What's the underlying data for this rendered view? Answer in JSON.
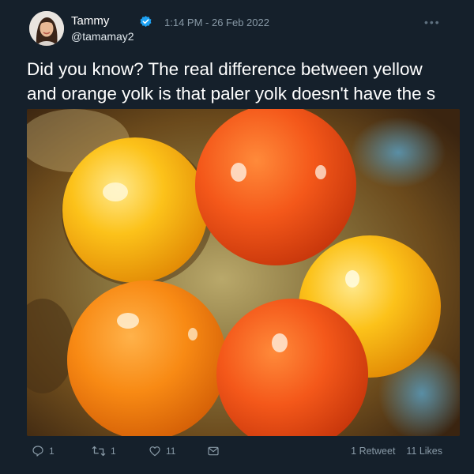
{
  "author": {
    "display_name": "Tammy",
    "handle": "@tamamay2",
    "verified": true,
    "avatar_icon": "person-avatar"
  },
  "timestamp": "1:14 PM - 26 Feb 2022",
  "more_icon": "ellipsis-icon",
  "text": "Did you know? The real difference between yellow and orange yolk is that paler yolk doesn't have the s",
  "text_lines": [
    "Did you know? The real difference between yellow",
    "and orange yolk is that paler yolk doesn't have the s"
  ],
  "actions": {
    "replies": "1",
    "retweets": "1",
    "likes": "11"
  },
  "stats": {
    "retweet_count": "1",
    "retweet_label": "Retweet",
    "like_count": "11",
    "like_label": "Likes"
  },
  "colors": {
    "background": "#15202b",
    "muted": "#8899a6",
    "verified": "#1da1f2"
  }
}
